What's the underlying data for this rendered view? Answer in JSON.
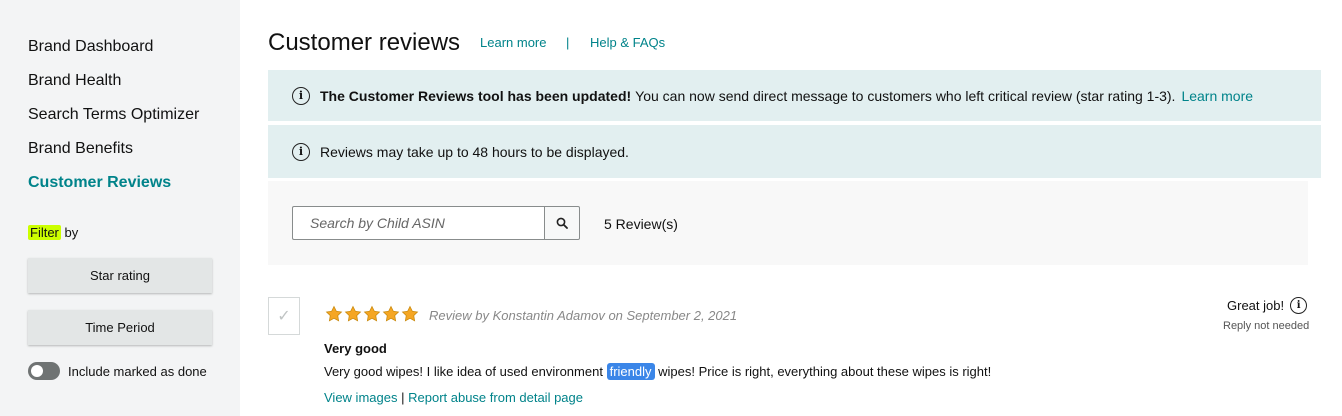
{
  "sidebar": {
    "items": [
      {
        "label": "Brand Dashboard"
      },
      {
        "label": "Brand Health"
      },
      {
        "label": "Search Terms Optimizer"
      },
      {
        "label": "Brand Benefits"
      },
      {
        "label": "Customer Reviews",
        "active": true
      }
    ],
    "filter_label": "Filter",
    "filter_by": "by",
    "star_rating_button": "Star rating",
    "time_period_button": "Time Period",
    "include_done_label": "Include marked as done",
    "include_done_on": false
  },
  "header": {
    "title": "Customer reviews",
    "learn_more": "Learn more",
    "separator": "|",
    "help": "Help & FAQs"
  },
  "banners": {
    "update_bold": "The Customer Reviews tool has been updated!",
    "update_text": "You can now send direct message to customers who left critical review (star rating 1-3).",
    "update_link": "Learn more",
    "delay_text": "Reviews may take up to 48 hours to be displayed."
  },
  "search": {
    "placeholder": "Search by Child ASIN",
    "count": "5 Review(s)"
  },
  "review": {
    "rating": 5,
    "meta": "Review by Konstantin Adamov on September 2, 2021",
    "title": "Very good",
    "body_before": "Very good wipes! I like idea of used environment",
    "body_highlight": "friendly",
    "body_after": "wipes! Price is right, everything about these wipes is right!",
    "view_images": "View images",
    "link_sep": "|",
    "report_abuse": "Report abuse from detail page",
    "status_label": "Great job!",
    "reply_status": "Reply not needed"
  },
  "icons": {
    "info": "info-icon",
    "search": "search-icon",
    "star": "star-icon",
    "check": "check-icon"
  },
  "colors": {
    "accent": "#00838a",
    "banner_bg": "#e2eff0",
    "sidebar_bg": "#f3f4f5",
    "star": "#f5a623",
    "highlight": "#3b86e8",
    "filter_highlight": "#ccff00"
  }
}
